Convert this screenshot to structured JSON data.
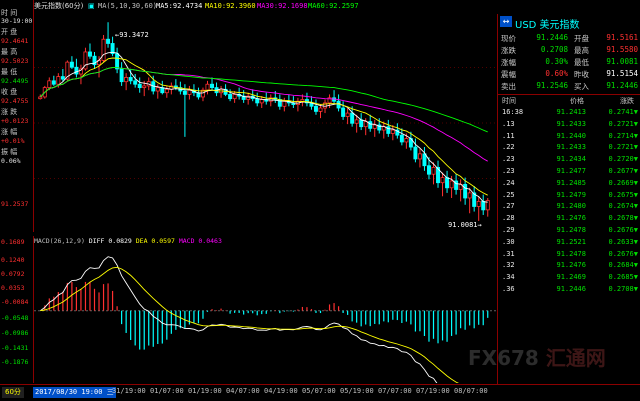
{
  "window": {
    "tab_label": "美元指数(60分)",
    "period_badge": "60分"
  },
  "ma_bar": {
    "ma_label": "MA(5,10,30,60)",
    "ma5": "MA5:92.4734",
    "ma10": "MA10:92.3960",
    "ma30": "MA30:92.1698",
    "ma60": "MA60:92.2597",
    "colors": {
      "ma5": "#ffffff",
      "ma10": "#ffff00",
      "ma30": "#ff00ff",
      "ma60": "#00ff00"
    }
  },
  "left_panel": {
    "time_label": "时 间",
    "time_value": "30-19:00",
    "open_label": "开 盘",
    "open_value": "92.4641",
    "high_label": "最 高",
    "high_value": "92.5023",
    "low_label": "最 低",
    "low_value": "92.4495",
    "close_label": "收 盘",
    "close_value": "92.4755",
    "change_label": "涨 跌",
    "change_value": "+0.0123",
    "pct_label": "涨 幅",
    "pct_value": "+0.01%",
    "amp_label": "振 幅",
    "amp_value": "0.06%"
  },
  "price_chart": {
    "y_axis_label": "91.2537",
    "high_marker": "←93.3472",
    "low_marker": "91.0081→",
    "candles": [
      [
        92.45,
        92.5,
        92.44,
        92.47
      ],
      [
        92.47,
        92.6,
        92.45,
        92.58
      ],
      [
        92.58,
        92.7,
        92.55,
        92.66
      ],
      [
        92.66,
        92.72,
        92.6,
        92.62
      ],
      [
        92.62,
        92.75,
        92.58,
        92.71
      ],
      [
        92.71,
        92.8,
        92.65,
        92.68
      ],
      [
        92.68,
        92.9,
        92.66,
        92.88
      ],
      [
        92.88,
        92.95,
        92.8,
        92.82
      ],
      [
        92.82,
        92.92,
        92.7,
        92.74
      ],
      [
        92.74,
        92.85,
        92.62,
        92.8
      ],
      [
        92.8,
        93.05,
        92.78,
        93.0
      ],
      [
        93.0,
        93.1,
        92.92,
        92.95
      ],
      [
        92.95,
        93.0,
        92.8,
        92.85
      ],
      [
        92.85,
        92.95,
        92.7,
        92.9
      ],
      [
        92.9,
        93.2,
        92.88,
        93.15
      ],
      [
        93.15,
        93.35,
        93.05,
        93.1
      ],
      [
        93.1,
        93.18,
        92.95,
        92.98
      ],
      [
        92.98,
        93.05,
        92.75,
        92.8
      ],
      [
        92.8,
        92.88,
        92.6,
        92.65
      ],
      [
        92.65,
        92.75,
        92.55,
        92.7
      ],
      [
        92.7,
        92.8,
        92.62,
        92.66
      ],
      [
        92.66,
        92.74,
        92.58,
        92.62
      ],
      [
        92.62,
        92.7,
        92.52,
        92.58
      ],
      [
        92.58,
        92.66,
        92.48,
        92.6
      ],
      [
        92.6,
        92.7,
        92.55,
        92.65
      ],
      [
        92.65,
        92.72,
        92.5,
        92.54
      ],
      [
        92.54,
        92.62,
        92.45,
        92.58
      ],
      [
        92.58,
        92.66,
        92.5,
        92.52
      ],
      [
        92.52,
        92.6,
        92.46,
        92.56
      ],
      [
        92.56,
        92.64,
        92.5,
        92.6
      ],
      [
        92.6,
        92.68,
        92.55,
        92.58
      ],
      [
        92.58,
        92.65,
        92.5,
        92.54
      ],
      [
        92.54,
        92.62,
        92.0,
        92.5
      ],
      [
        92.5,
        92.6,
        92.44,
        92.55
      ],
      [
        92.55,
        92.62,
        92.48,
        92.52
      ],
      [
        92.52,
        92.58,
        92.44,
        92.47
      ],
      [
        92.47,
        92.58,
        92.42,
        92.55
      ],
      [
        92.55,
        92.66,
        92.5,
        92.62
      ],
      [
        92.62,
        92.7,
        92.55,
        92.58
      ],
      [
        92.58,
        92.64,
        92.48,
        92.52
      ],
      [
        92.52,
        92.6,
        92.46,
        92.56
      ],
      [
        92.56,
        92.62,
        92.48,
        92.5
      ],
      [
        92.5,
        92.56,
        92.42,
        92.45
      ],
      [
        92.45,
        92.54,
        92.4,
        92.5
      ],
      [
        92.5,
        92.58,
        92.44,
        92.48
      ],
      [
        92.48,
        92.55,
        92.4,
        92.44
      ],
      [
        92.44,
        92.52,
        92.38,
        92.48
      ],
      [
        92.48,
        92.56,
        92.42,
        92.45
      ],
      [
        92.45,
        92.52,
        92.36,
        92.4
      ],
      [
        92.4,
        92.48,
        92.34,
        92.44
      ],
      [
        92.44,
        92.52,
        92.38,
        92.42
      ],
      [
        92.42,
        92.5,
        92.36,
        92.46
      ],
      [
        92.46,
        92.54,
        92.4,
        92.44
      ],
      [
        92.44,
        92.5,
        92.32,
        92.36
      ],
      [
        92.36,
        92.46,
        92.3,
        92.42
      ],
      [
        92.42,
        92.5,
        92.36,
        92.4
      ],
      [
        92.4,
        92.48,
        92.34,
        92.38
      ],
      [
        92.38,
        92.46,
        92.3,
        92.42
      ],
      [
        92.42,
        92.5,
        92.36,
        92.44
      ],
      [
        92.44,
        92.52,
        92.36,
        92.4
      ],
      [
        92.4,
        92.48,
        92.32,
        92.36
      ],
      [
        92.36,
        92.44,
        92.26,
        92.3
      ],
      [
        92.3,
        92.38,
        92.22,
        92.34
      ],
      [
        92.34,
        92.44,
        92.28,
        92.4
      ],
      [
        92.4,
        92.5,
        92.34,
        92.46
      ],
      [
        92.46,
        92.55,
        92.38,
        92.42
      ],
      [
        92.42,
        92.5,
        92.3,
        92.34
      ],
      [
        92.34,
        92.42,
        92.2,
        92.24
      ],
      [
        92.24,
        92.34,
        92.15,
        92.28
      ],
      [
        92.28,
        92.36,
        92.12,
        92.16
      ],
      [
        92.16,
        92.26,
        92.05,
        92.2
      ],
      [
        92.2,
        92.28,
        92.08,
        92.12
      ],
      [
        92.12,
        92.22,
        92.02,
        92.18
      ],
      [
        92.18,
        92.26,
        92.06,
        92.1
      ],
      [
        92.1,
        92.2,
        92.0,
        92.14
      ],
      [
        92.14,
        92.22,
        92.04,
        92.08
      ],
      [
        92.08,
        92.18,
        91.98,
        92.12
      ],
      [
        92.12,
        92.2,
        92.0,
        92.04
      ],
      [
        92.04,
        92.14,
        91.96,
        92.08
      ],
      [
        92.08,
        92.16,
        91.98,
        92.02
      ],
      [
        92.02,
        92.1,
        91.9,
        91.94
      ],
      [
        91.94,
        92.04,
        91.86,
        91.98
      ],
      [
        91.98,
        92.06,
        91.84,
        91.88
      ],
      [
        91.88,
        91.98,
        91.7,
        91.74
      ],
      [
        91.74,
        91.86,
        91.64,
        91.8
      ],
      [
        91.8,
        91.88,
        91.6,
        91.66
      ],
      [
        91.66,
        91.76,
        91.5,
        91.56
      ],
      [
        91.56,
        91.7,
        91.44,
        91.64
      ],
      [
        91.64,
        91.72,
        91.4,
        91.46
      ],
      [
        91.46,
        91.58,
        91.3,
        91.52
      ],
      [
        91.52,
        91.6,
        91.34,
        91.4
      ],
      [
        91.4,
        91.54,
        91.28,
        91.48
      ],
      [
        91.48,
        91.56,
        91.32,
        91.38
      ],
      [
        91.38,
        91.5,
        91.24,
        91.44
      ],
      [
        91.44,
        91.52,
        91.2,
        91.28
      ],
      [
        91.28,
        91.4,
        91.1,
        91.34
      ],
      [
        91.34,
        91.42,
        91.12,
        91.18
      ],
      [
        91.18,
        91.3,
        91.01,
        91.24
      ],
      [
        91.24,
        91.32,
        91.08,
        91.14
      ],
      [
        91.14,
        91.28,
        91.06,
        91.25
      ]
    ]
  },
  "macd_bar": {
    "label": "MACD(26,12,9)",
    "diff": "DIFF 0.0829",
    "dea": "DEA 0.0597",
    "macd": "MACD 0.0463"
  },
  "macd_axis": [
    "0.1689",
    "0.1240",
    "0.0792",
    "0.0353",
    "-0.0084",
    "-0.0548",
    "-0.0986",
    "-0.1431",
    "-0.1876"
  ],
  "bottom_bar": {
    "start_date": "2017/08/30 19:00 三",
    "dates": [
      "31/19:00",
      "01/07:00",
      "01/19:00",
      "04/07:00",
      "04/19:00",
      "05/07:00",
      "05/19:00",
      "07/07:00",
      "07/19:00",
      "08/07:00"
    ]
  },
  "quote": {
    "title": "USD 美元指数",
    "rows": [
      {
        "l1": "现价",
        "v1": "91.2446",
        "c1": "#00e000",
        "l2": "开盘",
        "v2": "91.5161",
        "c2": "#ff3030"
      },
      {
        "l1": "涨跌",
        "v1": "0.2708",
        "c1": "#00e000",
        "l2": "最高",
        "v2": "91.5580",
        "c2": "#ff3030"
      },
      {
        "l1": "涨幅",
        "v1": "0.30%",
        "c1": "#00e000",
        "l2": "最低",
        "v2": "91.0081",
        "c2": "#00e000"
      },
      {
        "l1": "震幅",
        "v1": "0.60%",
        "c1": "#ff3030",
        "l2": "昨收",
        "v2": "91.5154",
        "c2": "#ffffff"
      },
      {
        "l1": "卖出",
        "v1": "91.2546",
        "c1": "#00e000",
        "l2": "买入",
        "v2": "91.2446",
        "c2": "#00e000"
      }
    ]
  },
  "ticks": {
    "headers": [
      "时间",
      "价格",
      "涨跌"
    ],
    "rows": [
      {
        "t": "16:38",
        "p": "91.2413",
        "c": "0.2741▼"
      },
      {
        "t": ".13",
        "p": "91.2433",
        "c": "0.2721▼"
      },
      {
        "t": ".11",
        "p": "91.2440",
        "c": "0.2714▼"
      },
      {
        "t": ".22",
        "p": "91.2433",
        "c": "0.2721▼"
      },
      {
        "t": ".23",
        "p": "91.2434",
        "c": "0.2720▼"
      },
      {
        "t": ".23",
        "p": "91.2477",
        "c": "0.2677▼"
      },
      {
        "t": ".24",
        "p": "91.2485",
        "c": "0.2669▼"
      },
      {
        "t": ".25",
        "p": "91.2479",
        "c": "0.2675▼"
      },
      {
        "t": ".27",
        "p": "91.2480",
        "c": "0.2674▼"
      },
      {
        "t": ".28",
        "p": "91.2476",
        "c": "0.2678▼"
      },
      {
        "t": ".29",
        "p": "91.2478",
        "c": "0.2676▼"
      },
      {
        "t": ".30",
        "p": "91.2521",
        "c": "0.2633▼"
      },
      {
        "t": ".31",
        "p": "91.2478",
        "c": "0.2676▼"
      },
      {
        "t": ".32",
        "p": "91.2476",
        "c": "0.2684▼"
      },
      {
        "t": ".34",
        "p": "91.2469",
        "c": "0.2685▼"
      },
      {
        "t": ".36",
        "p": "91.2446",
        "c": "0.2708▼"
      }
    ]
  },
  "watermark": {
    "brand": "FX678",
    "brand_cn": "汇通网"
  }
}
